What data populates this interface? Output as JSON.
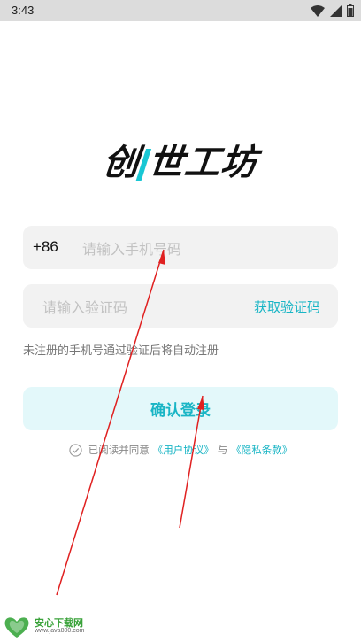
{
  "status_bar": {
    "time": "3:43"
  },
  "logo": {
    "prefix": "创",
    "rest": "世工坊"
  },
  "phone": {
    "country_code": "+86",
    "placeholder": "请输入手机号码"
  },
  "code": {
    "placeholder": "请输入验证码",
    "get_code_label": "获取验证码"
  },
  "hint": "未注册的手机号通过验证后将自动注册",
  "login_label": "确认登录",
  "agreement": {
    "prefix": "已阅读并同意",
    "user_agreement": "《用户协议》",
    "joiner": "与",
    "privacy_policy": "《隐私条款》"
  },
  "watermark": {
    "title": "安心下载网",
    "url": "www.java800.com"
  },
  "colors": {
    "accent": "#19b5c5",
    "annotation_arrow": "#e02020"
  }
}
